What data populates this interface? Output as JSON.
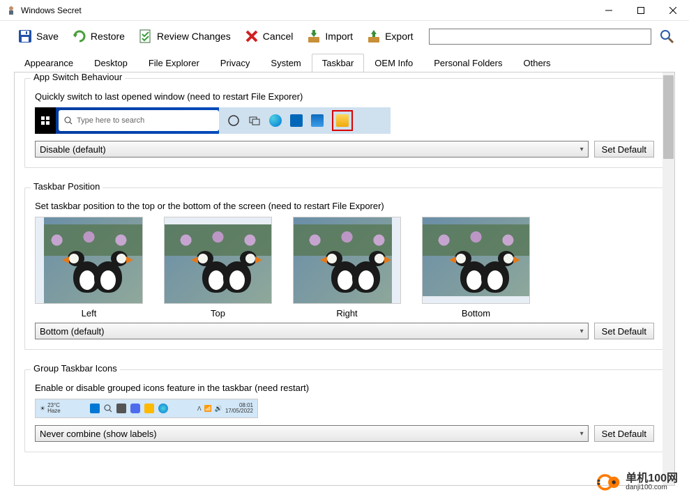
{
  "window": {
    "title": "Windows Secret"
  },
  "toolbar": {
    "save": "Save",
    "restore": "Restore",
    "review": "Review Changes",
    "cancel": "Cancel",
    "import": "Import",
    "export": "Export",
    "search_value": ""
  },
  "tabs": {
    "items": [
      "Appearance",
      "Desktop",
      "File Explorer",
      "Privacy",
      "System",
      "Taskbar",
      "OEM Info",
      "Personal Folders",
      "Others"
    ],
    "active": "Taskbar"
  },
  "sections": {
    "switch": {
      "legend": "App Switch Behaviour",
      "desc": "Quickly switch to last opened window  (need to restart File Exporer)",
      "preview_search": "Type here to search",
      "dropdown": "Disable (default)",
      "btn": "Set Default"
    },
    "position": {
      "legend": "Taskbar Position",
      "desc": "Set taskbar position to the top or the bottom of the screen  (need to restart File Exporer)",
      "labels": [
        "Left",
        "Top",
        "Right",
        "Bottom"
      ],
      "dropdown": "Bottom (default)",
      "btn": "Set Default"
    },
    "group": {
      "legend": "Group Taskbar Icons",
      "desc": "Enable or disable  grouped icons feature in the taskbar (need restart)",
      "preview_temp": "23°C",
      "preview_haze": "Haze",
      "preview_time": "08:01",
      "preview_date": "17/05/2022",
      "dropdown": "Never combine (show labels)",
      "btn": "Set Default"
    }
  },
  "watermark": {
    "cn": "单机100网",
    "en": "danji100.com"
  }
}
